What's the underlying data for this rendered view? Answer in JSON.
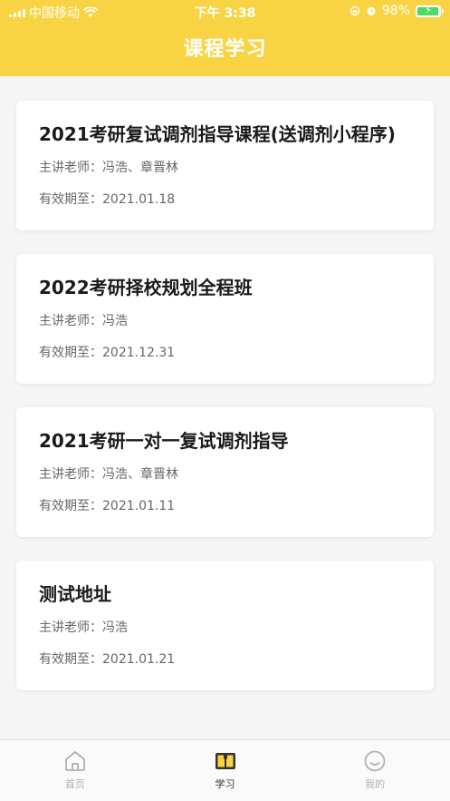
{
  "status_bar": {
    "carrier": "中国移动",
    "time": "下午 3:38",
    "battery_percent": "98%",
    "battery_level": 0.98
  },
  "header": {
    "title": "课程学习",
    "background_color": "#f8d444"
  },
  "courses": [
    {
      "title": "2021考研复试调剂指导课程(送调剂小程序)",
      "teacher": "主讲老师：冯浩、章晋林",
      "expire": "有效期至：2021.01.18"
    },
    {
      "title": "2022考研择校规划全程班",
      "teacher": "主讲老师：冯浩",
      "expire": "有效期至：2021.12.31"
    },
    {
      "title": "2021考研一对一复试调剂指导",
      "teacher": "主讲老师：冯浩、章晋林",
      "expire": "有效期至：2021.01.11"
    },
    {
      "title": "测试地址",
      "teacher": "主讲老师：冯浩",
      "expire": "有效期至：2021.01.21"
    }
  ],
  "tabbar": {
    "items": [
      {
        "label": "首页",
        "icon": "home-icon",
        "active": false
      },
      {
        "label": "学习",
        "icon": "book-icon",
        "active": true
      },
      {
        "label": "我的",
        "icon": "smiley-icon",
        "active": false
      }
    ]
  }
}
